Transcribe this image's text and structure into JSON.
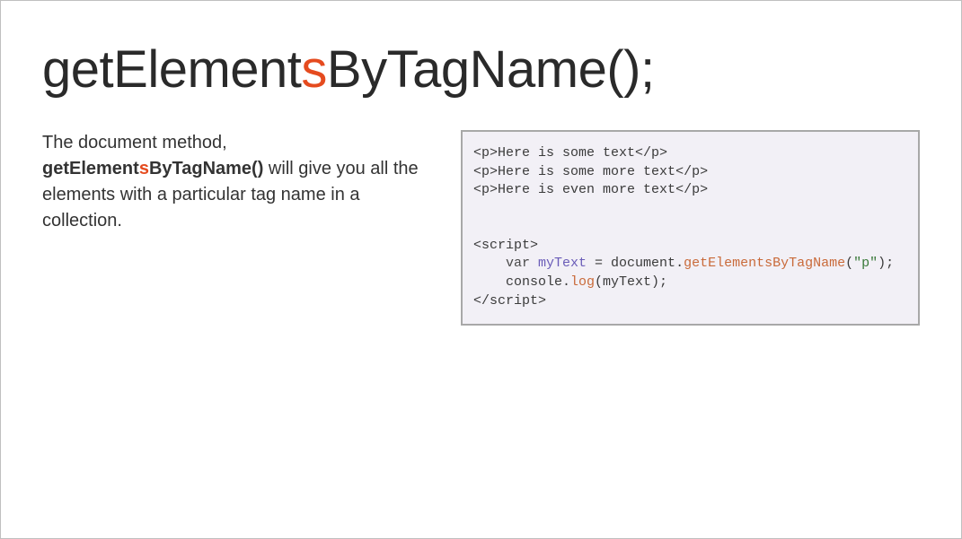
{
  "title": {
    "pre": "getElement",
    "hl": "s",
    "post": "ByTagName();"
  },
  "desc": {
    "line1": "The document method, ",
    "bold_pre": "getElement",
    "bold_hl": "s",
    "bold_post": "ByTagName()",
    "line2": " will give you all the elements with a particular tag name in a collection."
  },
  "code": {
    "p1_open": "<p>",
    "p1_text": "Here is some text",
    "p1_close": "</p>",
    "p2_open": "<p>",
    "p2_text": "Here is some more text",
    "p2_close": "</p>",
    "p3_open": "<p>",
    "p3_text": "Here is even more text",
    "p3_close": "</p>",
    "script_open": "<script>",
    "indent": "    ",
    "var_kw": "var ",
    "var_name": "myText",
    "eq": " = document.",
    "method": "getElementsByTagName",
    "arg_open": "(",
    "arg_str": "\"p\"",
    "arg_close": ");",
    "console": "console.",
    "log_fn": "log",
    "log_arg": "(myText);",
    "script_close": "</scr"
  },
  "script_close_tail": "ipt>"
}
